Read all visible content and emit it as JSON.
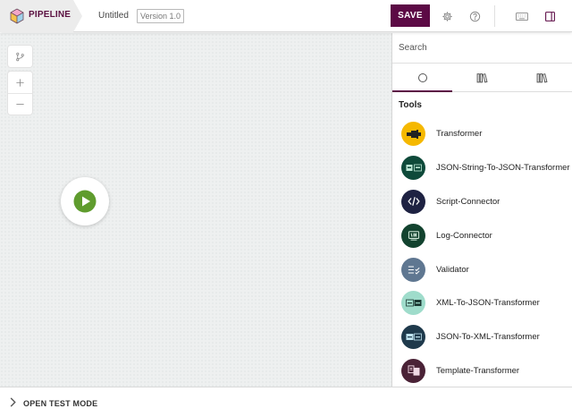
{
  "header": {
    "brand": "PIPELINE",
    "doc_title": "Untitled",
    "version": "Version 1.0",
    "save_label": "SAVE",
    "icons": [
      "gear-icon",
      "help-icon",
      "keyboard-icon",
      "panel-toggle-icon"
    ]
  },
  "canvas": {
    "controls": [
      "branch-icon",
      "zoom-in-icon",
      "zoom-out-icon"
    ],
    "start_node_icon": "play-icon"
  },
  "panel": {
    "search_placeholder": "Search",
    "tabs": [
      "circle-icon",
      "library-icon",
      "library-icon"
    ],
    "section_title": "Tools",
    "tools": [
      {
        "label": "Transformer",
        "icon": "transformer-icon",
        "color": "#f5b800"
      },
      {
        "label": "JSON-String-To-JSON-Transformer",
        "icon": "json-icon",
        "color": "#0e4a3a"
      },
      {
        "label": "Script-Connector",
        "icon": "code-icon",
        "color": "#1e2242"
      },
      {
        "label": "Log-Connector",
        "icon": "log-icon",
        "color": "#13432f"
      },
      {
        "label": "Validator",
        "icon": "checklist-icon",
        "color": "#5f7791"
      },
      {
        "label": "XML-To-JSON-Transformer",
        "icon": "xml-json-icon",
        "color": "#9fdccb"
      },
      {
        "label": "JSON-To-XML-Transformer",
        "icon": "json-xml-icon",
        "color": "#1f3a4c"
      },
      {
        "label": "Template-Transformer",
        "icon": "template-icon",
        "color": "#4a2236"
      }
    ]
  },
  "footer": {
    "test_mode_label": "OPEN TEST MODE"
  },
  "colors": {
    "accent": "#5c0a45",
    "start_node": "#5f9c2e"
  }
}
